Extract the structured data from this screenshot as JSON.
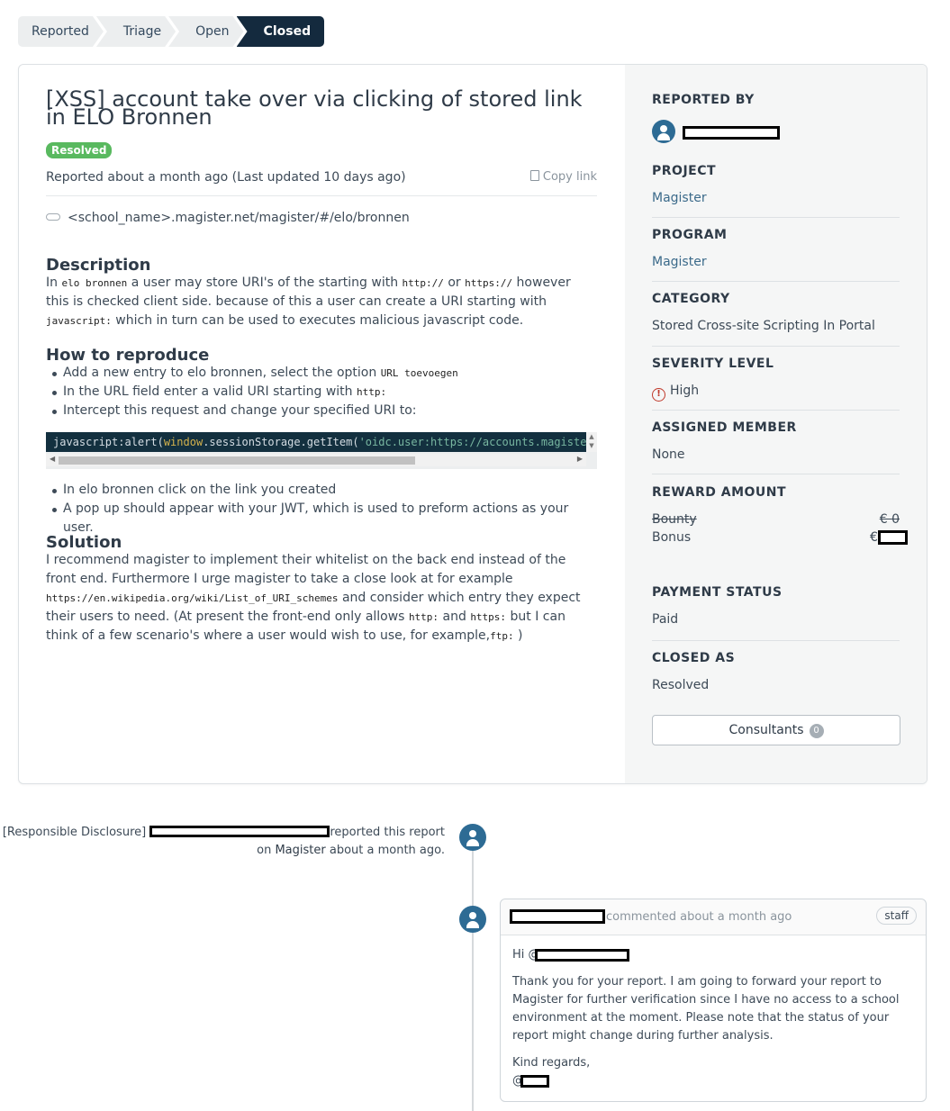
{
  "steps": [
    "Reported",
    "Triage",
    "Open",
    "Closed"
  ],
  "report": {
    "title": "[XSS] account take over via clicking of stored link in ELO Bronnen",
    "status_badge": "Resolved",
    "meta": "Reported about a month ago (Last updated 10 days ago)",
    "copy_link": "Copy link",
    "url": "<school_name>.magister.net/magister/#/elo/bronnen"
  },
  "description": {
    "heading": "Description",
    "p1_a": "In ",
    "p1_code1": "elo bronnen",
    "p1_b": " a user may store URI's of the starting with ",
    "p1_code2": "http://",
    "p1_c": " or ",
    "p1_code3": "https://",
    "p1_d": " however this is checked client side. because of this a user can create a URI starting with ",
    "p1_code4": "javascript:",
    "p1_e": " which in turn can be used to executes malicious javascript code."
  },
  "reproduce": {
    "heading": "How to reproduce",
    "b1": "Add a new entry to elo bronnen, select the option ",
    "b1_code": "URL toevoegen",
    "b2": "In the URL field enter a valid URI starting with ",
    "b2_code": "http:",
    "b3": "Intercept this request and change your specified URI to:",
    "code_a": "javascript:alert(",
    "code_b": "window",
    "code_c": ".sessionStorage.getItem(",
    "code_d": "'oidc.user:https://accounts.magister.n",
    "b4": "In elo bronnen click on the link you created",
    "b5": "A pop up should appear with your JWT, which is used to preform actions as your user."
  },
  "solution": {
    "heading": "Solution",
    "p_a": "I recommend magister to implement their whitelist on the back end instead of the front end. Furthermore I urge magister to take a close look at for example ",
    "p_code1": "https://en.wikipedia.org/wiki/List_of_URI_schemes",
    "p_b": " and consider which entry they expect their users to need. (At present the front-end only allows ",
    "p_code2": "http:",
    "p_c": " and ",
    "p_code3": "https:",
    "p_d": " but I can think of a few scenario's where a user would wish to use, for example,",
    "p_code4": "ftp:",
    "p_e": " )"
  },
  "sidebar": {
    "reported_by_label": "REPORTED BY",
    "project_label": "PROJECT",
    "project": "Magister",
    "program_label": "PROGRAM",
    "program": "Magister",
    "category_label": "CATEGORY",
    "category": "Stored Cross-site Scripting In Portal",
    "severity_label": "SEVERITY LEVEL",
    "severity": "High",
    "assigned_label": "ASSIGNED MEMBER",
    "assigned": "None",
    "reward_label": "REWARD AMOUNT",
    "bounty_label": "Bounty",
    "bounty_value": "€ 0",
    "bonus_label": "Bonus",
    "bonus_currency": "€",
    "payment_label": "PAYMENT STATUS",
    "payment": "Paid",
    "closed_label": "CLOSED AS",
    "closed": "Resolved",
    "consultants_label": "Consultants",
    "consultants_count": "0"
  },
  "timeline": {
    "event1_prefix": "[Responsible Disclosure]",
    "event1_suffix": "reported this report",
    "event1_on": "on ",
    "event1_project": "Magister",
    "event1_time": " about a month ago.",
    "comment_meta": "commented about a month ago",
    "comment_tag": "staff",
    "comment_greeting": "Hi @",
    "comment_body": "Thank you for your report. I am going to forward your report to Magister for further verification since I have no access to a school environment at the moment. Please note that the status of your report might change during further analysis.",
    "comment_signoff": "Kind regards,",
    "comment_at": "@"
  },
  "colors": {
    "badge": "#59b95f",
    "active_step": "#142a3e",
    "avatar": "#2d6b94",
    "severity": "#c0392b"
  }
}
